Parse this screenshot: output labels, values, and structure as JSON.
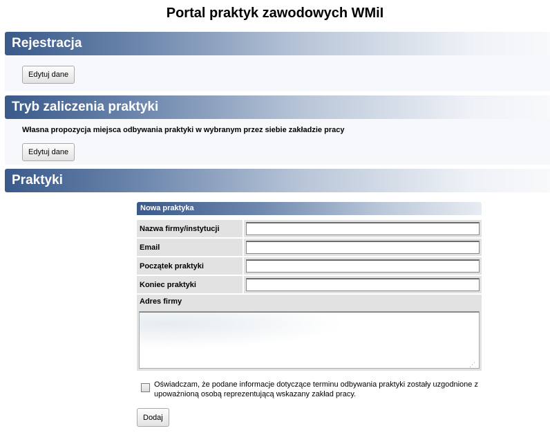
{
  "page": {
    "title": "Portal praktyk zawodowych WMiI"
  },
  "registration": {
    "header": "Rejestracja",
    "edit_label": "Edytuj dane"
  },
  "completion_mode": {
    "header": "Tryb zaliczenia praktyki",
    "description": "Własna propozycja miejsca odbywania praktyki w wybranym przez siebie zakładzie pracy",
    "edit_label": "Edytuj dane"
  },
  "internships": {
    "header": "Praktyki",
    "form": {
      "title": "Nowa praktyka",
      "fields": [
        {
          "label": "Nazwa firmy/instytucji",
          "value": ""
        },
        {
          "label": "Email",
          "value": ""
        },
        {
          "label": "Początek praktyki",
          "value": ""
        },
        {
          "label": "Koniec praktyki",
          "value": ""
        }
      ],
      "address_label": "Adres firmy",
      "address_value": "",
      "consent_text": "Oświadczam, że podane informacje dotyczące terminu odbywania praktyki zostały uzgodnione z upoważnioną osobą reprezentującą wskazany zakład pracy.",
      "consent_checked": false,
      "submit_label": "Dodaj"
    }
  },
  "colors": {
    "header_start": "#3a5a8a",
    "header_end": "#f8f9fb",
    "field_bg": "#e2e2e2"
  }
}
